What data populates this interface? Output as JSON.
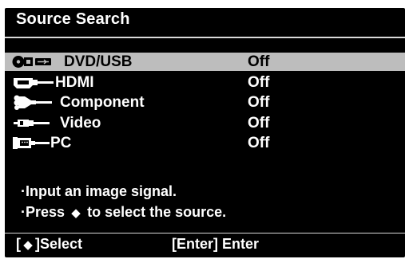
{
  "header": {
    "title": "Source Search"
  },
  "sources": [
    {
      "name": "DVD/USB",
      "state": "Off",
      "icon": "dvd-usb-icon",
      "selected": true
    },
    {
      "name": "HDMI",
      "state": "Off",
      "icon": "hdmi-icon",
      "selected": false
    },
    {
      "name": "Component",
      "state": "Off",
      "icon": "component-icon",
      "selected": false
    },
    {
      "name": "Video",
      "state": "Off",
      "icon": "video-icon",
      "selected": false
    },
    {
      "name": "PC",
      "state": "Off",
      "icon": "pc-icon",
      "selected": false
    }
  ],
  "help": {
    "line1": "·Input an image signal.",
    "line2_prefix": "·Press",
    "line2_suffix": "to select the source."
  },
  "footer": {
    "select_open": "[",
    "select_close": "]Select",
    "enter": "[Enter] Enter"
  },
  "colors": {
    "background": "#000000",
    "text": "#ffffff",
    "selected_row": "#bdbdbd"
  }
}
